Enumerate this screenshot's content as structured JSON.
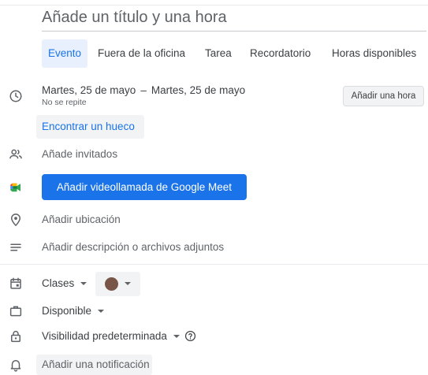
{
  "title": {
    "placeholder": "Añade un título y una hora"
  },
  "tabs": [
    {
      "label": "Evento",
      "active": true
    },
    {
      "label": "Fuera de la oficina",
      "active": false
    },
    {
      "label": "Tarea",
      "active": false
    },
    {
      "label": "Recordatorio",
      "active": false
    },
    {
      "label": "Horas disponibles",
      "active": false
    }
  ],
  "datetime": {
    "start": "Martes, 25 de mayo",
    "separator": "–",
    "end": "Martes, 25 de mayo",
    "repeat": "No se repite",
    "add_time_label": "Añadir una hora",
    "find_slot_label": "Encontrar un hueco"
  },
  "guests": {
    "placeholder": "Añade invitados"
  },
  "meet": {
    "label": "Añadir videollamada de Google Meet"
  },
  "location": {
    "placeholder": "Añadir ubicación"
  },
  "description": {
    "placeholder": "Añadir descripción o archivos adjuntos"
  },
  "calendar": {
    "name": "Clases",
    "color": "#795548"
  },
  "availability": {
    "value": "Disponible"
  },
  "visibility": {
    "value": "Visibilidad predeterminada"
  },
  "notification": {
    "label": "Añadir una notificación"
  },
  "colors": {
    "accent": "#1a73e8",
    "accent_bg": "#e8f0fe",
    "chip_bg": "#f1f3f4"
  },
  "icons": {
    "time": "clock-icon",
    "guests": "people-icon",
    "meet": "google-meet-icon",
    "location": "location-pin-icon",
    "description": "notes-icon",
    "calendar": "calendar-icon",
    "availability": "briefcase-icon",
    "visibility": "lock-icon",
    "notification": "bell-icon",
    "help": "help-circle-icon"
  }
}
